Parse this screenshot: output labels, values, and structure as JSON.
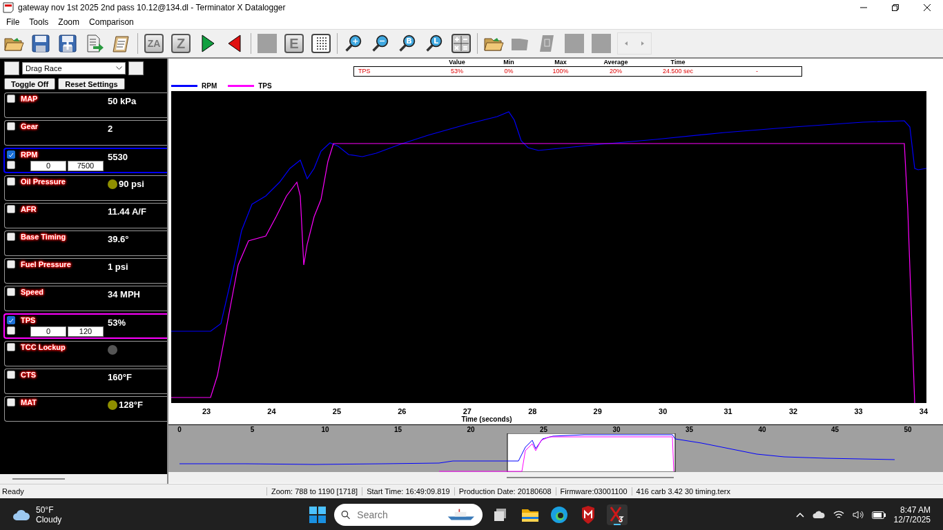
{
  "window": {
    "title": "gateway nov 1st 2025 2nd pass 10.12@134.dl - Terminator X Datalogger"
  },
  "menu": [
    "File",
    "Tools",
    "Zoom",
    "Comparison"
  ],
  "toolbar": [
    {
      "kind": "open-folder",
      "disabled": false
    },
    {
      "kind": "save",
      "disabled": false
    },
    {
      "kind": "save-plus",
      "disabled": false
    },
    {
      "kind": "export",
      "disabled": false
    },
    {
      "kind": "clipboard",
      "disabled": false
    },
    {
      "kind": "sep"
    },
    {
      "kind": "letter",
      "glyph": "ZA",
      "disabled": false
    },
    {
      "kind": "letter",
      "glyph": "Z",
      "disabled": false
    },
    {
      "kind": "play",
      "disabled": false
    },
    {
      "kind": "reverse",
      "disabled": false
    },
    {
      "kind": "sep"
    },
    {
      "kind": "blank",
      "disabled": true
    },
    {
      "kind": "letter",
      "glyph": "E",
      "disabled": false
    },
    {
      "kind": "dots",
      "disabled": false
    },
    {
      "kind": "sep"
    },
    {
      "kind": "magnifier",
      "glyph": "+",
      "disabled": false
    },
    {
      "kind": "magnifier",
      "glyph": "−",
      "disabled": false
    },
    {
      "kind": "magnifier",
      "glyph": "B",
      "disabled": false
    },
    {
      "kind": "magnifier",
      "glyph": "L",
      "disabled": false
    },
    {
      "kind": "calculator",
      "disabled": false
    },
    {
      "kind": "sep"
    },
    {
      "kind": "open-folder",
      "disabled": false
    },
    {
      "kind": "folder",
      "disabled": true
    },
    {
      "kind": "document",
      "disabled": true
    },
    {
      "kind": "blank",
      "disabled": true
    },
    {
      "kind": "blank",
      "disabled": true
    },
    {
      "kind": "scroll-arrows",
      "disabled": true
    }
  ],
  "preset": {
    "value": "Drag Race"
  },
  "panel_buttons": [
    "Toggle Off",
    "Reset Settings"
  ],
  "channels": [
    {
      "name": "MAP",
      "value": "50 kPa",
      "checked": false
    },
    {
      "name": "Gear",
      "value": "2",
      "checked": false
    },
    {
      "name": "RPM",
      "value": "5530",
      "checked": true,
      "color": "#0000ff",
      "range": {
        "checked": false,
        "min": "0",
        "max": "7500"
      }
    },
    {
      "name": "Oil Pressure",
      "value": "90 psi",
      "checked": false,
      "indicator": {
        "color": "#8f8f00"
      }
    },
    {
      "name": "AFR",
      "value": "11.44 A/F",
      "checked": false
    },
    {
      "name": "Base Timing",
      "value": "39.6°",
      "checked": false
    },
    {
      "name": "Fuel Pressure",
      "value": "1 psi",
      "checked": false
    },
    {
      "name": "Speed",
      "value": "34 MPH",
      "checked": false
    },
    {
      "name": "TPS",
      "value": "53%",
      "checked": true,
      "color": "#ff00ff",
      "range": {
        "checked": false,
        "min": "0",
        "max": "120"
      }
    },
    {
      "name": "TCC Lockup",
      "checked": false,
      "indicator": {
        "color": "#555555"
      }
    },
    {
      "name": "CTS",
      "value": "160°F",
      "checked": false
    },
    {
      "name": "MAT",
      "value": "128°F",
      "checked": false,
      "indicator": {
        "color": "#8f8f00"
      }
    }
  ],
  "stats": {
    "columns": [
      "Value",
      "Min",
      "Max",
      "Average",
      "Time"
    ],
    "row": {
      "channel": "TPS",
      "cells": [
        "53%",
        "0%",
        "100%",
        "20%",
        "24.500 sec"
      ],
      "extra": "-"
    }
  },
  "legend": [
    {
      "name": "RPM",
      "color": "#0000ff"
    },
    {
      "name": "TPS",
      "color": "#ff00ff"
    }
  ],
  "x_axis": {
    "labels": [
      "23",
      "24",
      "25",
      "26",
      "27",
      "28",
      "29",
      "30",
      "31",
      "32",
      "33",
      "34"
    ],
    "title": "Time (seconds)"
  },
  "overview": {
    "labels": [
      "0",
      "5",
      "10",
      "15",
      "20",
      "25",
      "30",
      "35",
      "40",
      "45",
      "50"
    ]
  },
  "status_bar": [
    "Ready",
    "Zoom: 788 to 1190 [1718]",
    "Start Time: 16:49:09.819",
    "Production Date: 20180608",
    "Firmware:03001100",
    "416 carb 3.42 30 timing.terx"
  ],
  "taskbar": {
    "weather": {
      "temp": "50°F",
      "condition": "Cloudy"
    },
    "search": {
      "placeholder": "Search"
    },
    "time": "8:47 AM",
    "date": "12/7/2025"
  }
}
